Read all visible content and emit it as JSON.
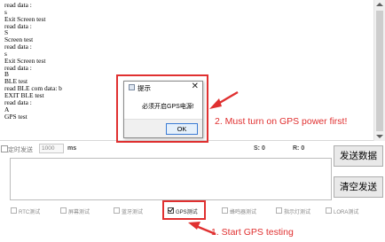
{
  "log": {
    "lines": [
      "read data :",
      "s",
      "Exit Screen test",
      "read data :",
      "S",
      "Screen test",
      "read data :",
      "s",
      "Exit Screen test",
      "read data :",
      "B",
      "BLE test",
      "read BLE com data: b",
      "EXIT BLE test",
      "read data :",
      "A",
      "GPS test"
    ]
  },
  "status": {
    "timed_send_label": "定时发送",
    "interval_value": "1000",
    "unit": "ms",
    "sent_count": "S: 0",
    "received_count": "R: 0"
  },
  "buttons": {
    "send": "发送数据",
    "clear": "清空发送"
  },
  "tests": [
    {
      "label": "RTC测试",
      "checked": false
    },
    {
      "label": "屏幕测试",
      "checked": false
    },
    {
      "label": "蓝牙测试",
      "checked": false
    },
    {
      "label": "GPS测试",
      "checked": true
    },
    {
      "label": "蜂鸣器测试",
      "checked": false
    },
    {
      "label": "指示灯测试",
      "checked": false
    },
    {
      "label": "LORA测试",
      "checked": false
    }
  ],
  "dialog": {
    "title": "提示",
    "close_glyph": "✕",
    "message": "必须开启GPS电源!",
    "ok": "OK"
  },
  "annotations": {
    "power": "2. Must turn on GPS power first!",
    "start": "1. Start GPS testing",
    "color": "#e03030"
  }
}
